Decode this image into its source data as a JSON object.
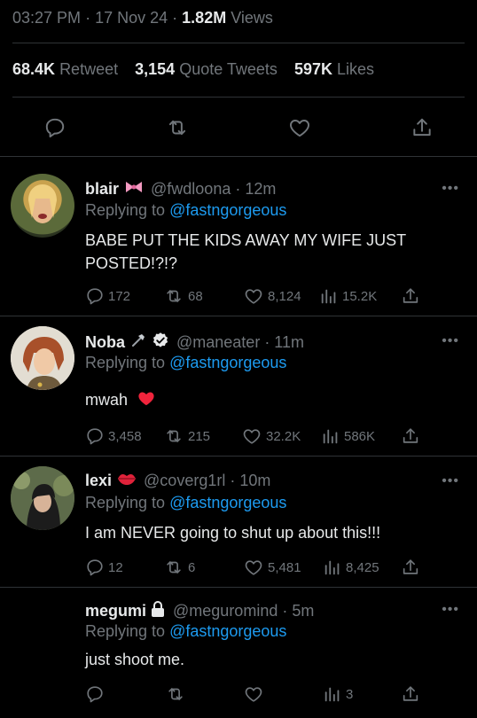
{
  "tweet": {
    "time": "03:27 PM",
    "sep1": "·",
    "date": "17 Nov 24",
    "sep2": "·",
    "views_count": "1.82M",
    "views_label": "Views",
    "retweets_count": "68.4K",
    "retweets_label": "Retweet",
    "quotes_count": "3,154",
    "quotes_label": "Quote Tweets",
    "likes_count": "597K",
    "likes_label": "Likes"
  },
  "replies": [
    {
      "name": "blair",
      "handle": "@fwdloona · 12m",
      "replying_label": "Replying to",
      "replying_to": "@fastngorgeous",
      "text": "BABE PUT THE KIDS AWAY MY WIFE JUST POSTED!?!?",
      "reply_count": "172",
      "retweet_count": "68",
      "like_count": "8,124",
      "view_count": "15.2K"
    },
    {
      "name": "Noba",
      "handle": "@maneater · 11m",
      "replying_label": "Replying to",
      "replying_to": "@fastngorgeous",
      "text": "mwah",
      "reply_count": "3,458",
      "retweet_count": "215",
      "like_count": "32.2K",
      "view_count": "586K"
    },
    {
      "name": "lexi",
      "handle": "@coverg1rl · 10m",
      "replying_label": "Replying to",
      "replying_to": "@fastngorgeous",
      "text": "I am NEVER going to shut up about this!!!",
      "reply_count": "12",
      "retweet_count": "6",
      "like_count": "5,481",
      "view_count": "8,425"
    },
    {
      "name": "megumi",
      "handle": "@meguromind · 5m",
      "replying_label": "Replying to",
      "replying_to": "@fastngorgeous",
      "text": "just shoot me.",
      "view_count": "3"
    }
  ],
  "more_glyph": "•••",
  "colors": {
    "background": "#000000",
    "text": "#e7e9ea",
    "muted": "#71767b",
    "link": "#1d9bf0",
    "divider": "#2f3336",
    "heart": "#f91880"
  }
}
